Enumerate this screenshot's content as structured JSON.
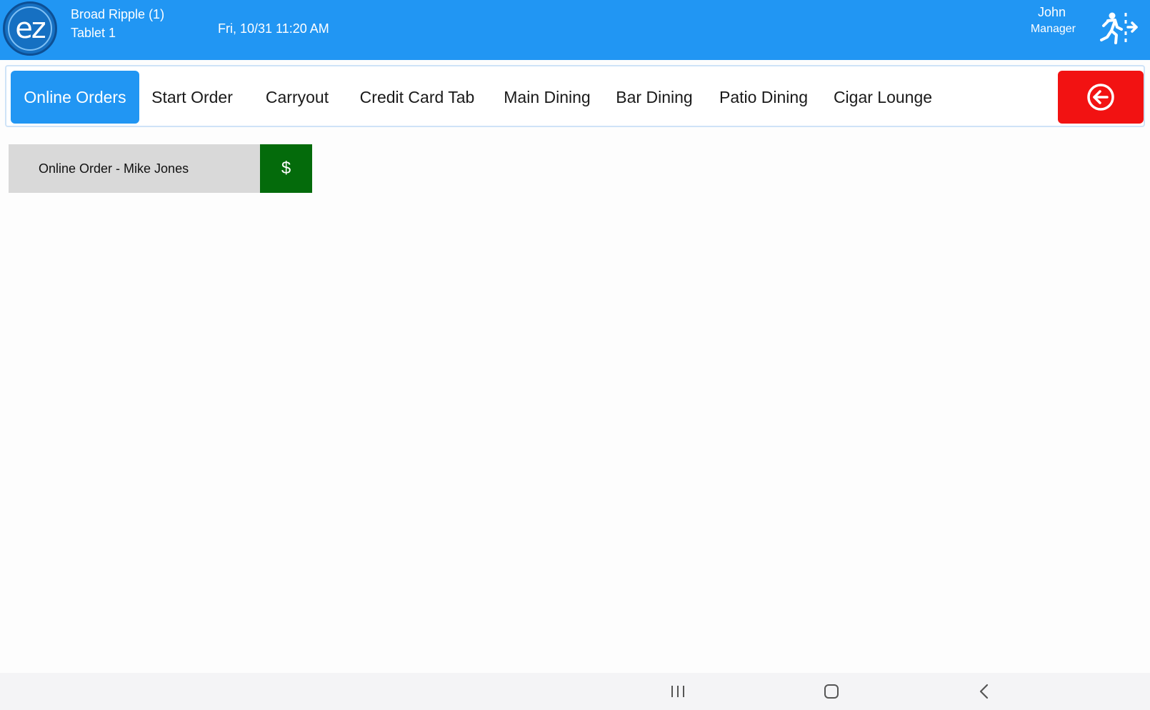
{
  "header": {
    "logo_text": "ez",
    "location": "Broad Ripple (1)",
    "device": "Tablet 1",
    "datetime": "Fri, 10/31 11:20 AM",
    "user_name": "John",
    "user_role": "Manager",
    "logout_icon": "exit-running-person-icon"
  },
  "tabs": [
    {
      "label": "Online Orders",
      "active": true
    },
    {
      "label": "Start Order",
      "active": false
    },
    {
      "label": "Carryout",
      "active": false
    },
    {
      "label": "Credit Card Tab",
      "active": false
    },
    {
      "label": "Main Dining",
      "active": false
    },
    {
      "label": "Bar Dining",
      "active": false
    },
    {
      "label": "Patio Dining",
      "active": false
    },
    {
      "label": "Cigar Lounge",
      "active": false
    }
  ],
  "back_button": {
    "icon": "circle-arrow-left-icon"
  },
  "orders": [
    {
      "label": "Online Order - Mike Jones",
      "pay_label": "$"
    }
  ],
  "navbar": {
    "recents_icon": "recents-icon",
    "home_icon": "home-icon",
    "back_icon": "back-chevron-icon"
  },
  "colors": {
    "header_bg": "#2196f3",
    "active_tab": "#2196f3",
    "back_button": "#f21212",
    "pay_button": "#046b0b",
    "order_bg": "#d9d9d9"
  }
}
